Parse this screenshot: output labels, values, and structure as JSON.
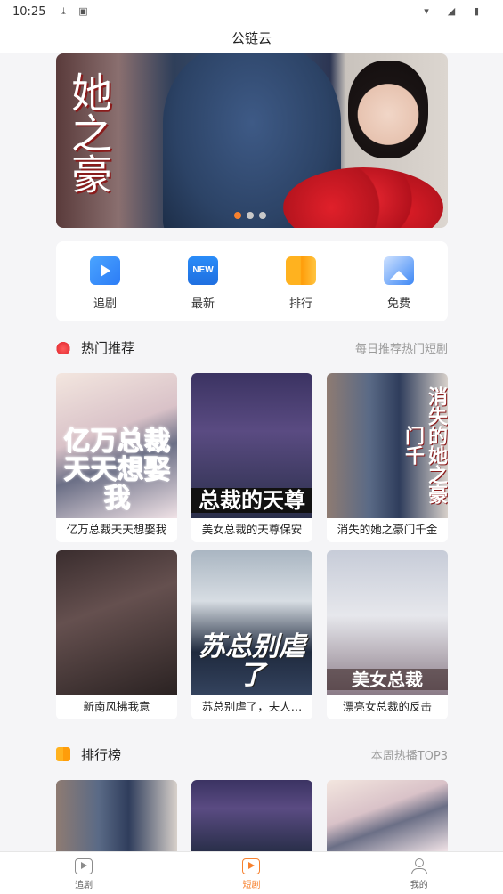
{
  "status_bar": {
    "time": "10:25",
    "icons": [
      "download-icon",
      "a-icon"
    ],
    "right_icons": [
      "wifi-icon",
      "signal-icon",
      "battery-icon"
    ]
  },
  "header": {
    "title": "公链云"
  },
  "banner": {
    "calligraphy": "她之豪",
    "dots": 3,
    "active_dot": 0,
    "accent_color": "#f7812e"
  },
  "quick_nav": [
    {
      "label": "追剧",
      "icon": "follow-play-icon"
    },
    {
      "label": "最新",
      "icon": "new-icon"
    },
    {
      "label": "排行",
      "icon": "rank-icon"
    },
    {
      "label": "免费",
      "icon": "free-image-icon"
    }
  ],
  "hot": {
    "title": "热门推荐",
    "subtitle": "每日推荐热门短剧",
    "items": [
      {
        "title": "亿万总裁天天想娶我",
        "poster_text": "亿万总裁天天想娶我"
      },
      {
        "title": "美女总裁的天尊保安",
        "poster_text": "总裁的天尊"
      },
      {
        "title": "消失的她之豪门千金",
        "poster_text": "消失的她之豪门千"
      },
      {
        "title": "新南风拂我意",
        "poster_text": ""
      },
      {
        "title": "苏总别虐了，夫人…",
        "poster_text": "苏总别虐了"
      },
      {
        "title": "漂亮女总裁的反击",
        "poster_text": "美女总裁"
      }
    ]
  },
  "ranking": {
    "title": "排行榜",
    "subtitle": "本周热播TOP3"
  },
  "tabbar": [
    {
      "label": "追剧",
      "active": false
    },
    {
      "label": "短剧",
      "active": true
    },
    {
      "label": "我的",
      "active": false
    }
  ]
}
